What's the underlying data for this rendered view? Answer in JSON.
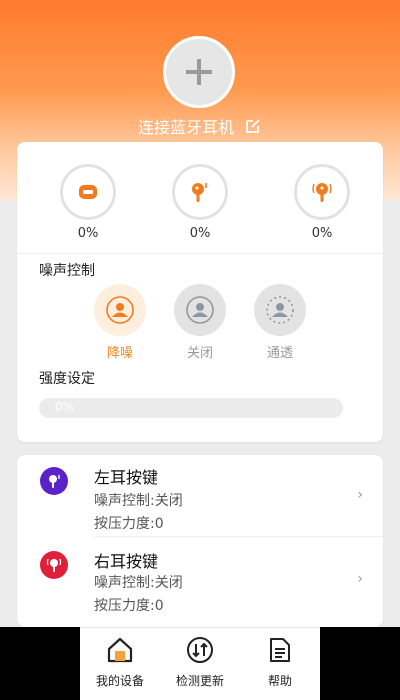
{
  "header": {
    "connect_label": "连接蓝牙耳机"
  },
  "battery": [
    {
      "name": "case",
      "value": "0%"
    },
    {
      "name": "left",
      "value": "0%"
    },
    {
      "name": "right",
      "value": "0%"
    }
  ],
  "noise_control": {
    "title": "噪声控制",
    "options": [
      {
        "label": "降噪",
        "active": true
      },
      {
        "label": "关闭",
        "active": false
      },
      {
        "label": "通透",
        "active": false
      }
    ]
  },
  "strength": {
    "title": "强度设定",
    "value_label": "0%",
    "value": 0
  },
  "keys": [
    {
      "title": "左耳按键",
      "noise": "噪声控制:关闭",
      "pressure": "按压力度:0"
    },
    {
      "title": "右耳按键",
      "noise": "噪声控制:关闭",
      "pressure": "按压力度:0"
    }
  ],
  "tabbar": [
    {
      "label": "我的设备",
      "icon": "home-icon"
    },
    {
      "label": "检测更新",
      "icon": "update-icon"
    },
    {
      "label": "帮助",
      "icon": "document-icon"
    }
  ],
  "colors": {
    "accent": "#ff8a3d",
    "left_badge": "#5a22c8",
    "right_badge": "#e0203a"
  }
}
